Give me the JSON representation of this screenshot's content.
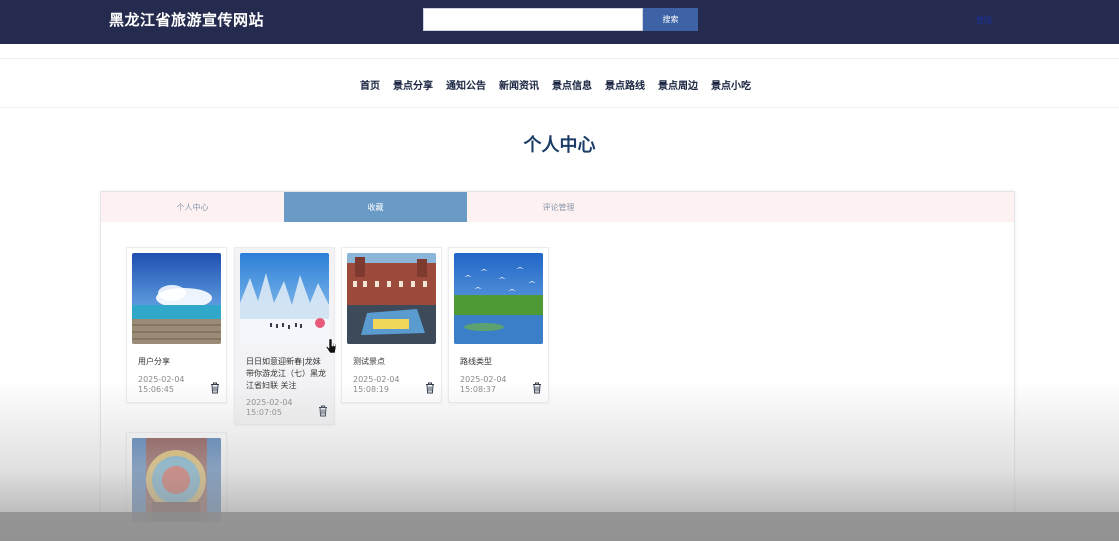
{
  "header": {
    "site_title": "黑龙江省旅游宣传网站",
    "search_placeholder": "",
    "search_button": "搜索",
    "login_link": "登陆"
  },
  "nav": {
    "items": [
      "首页",
      "景点分享",
      "通知公告",
      "新闻资讯",
      "景点信息",
      "景点路线",
      "景点周边",
      "景点小吃"
    ]
  },
  "page_title": "个人中心",
  "tabs": [
    {
      "label": "个人中心",
      "active": false
    },
    {
      "label": "收藏",
      "active": true
    },
    {
      "label": "评论管理",
      "active": false
    }
  ],
  "favorites": [
    {
      "title": "用户分享",
      "date": "2025-02-04",
      "time": "15:06:45",
      "image": "ocean-pier"
    },
    {
      "title": "日日如意迎新春|龙妹带你游龙江（七）黑龙江省妇联 关注",
      "date": "2025-02-04",
      "time": "15:07:05",
      "image": "snow-forest"
    },
    {
      "title": "测试景点",
      "date": "2025-02-04",
      "time": "15:08:19",
      "image": "castle-building"
    },
    {
      "title": "路线类型",
      "date": "2025-02-04",
      "time": "15:08:37",
      "image": "wetland-birds"
    },
    {
      "title": "",
      "date": "",
      "time": "",
      "image": "ornate-plate"
    }
  ],
  "colors": {
    "topbar": "#252b4f",
    "search_button": "#3d63a6",
    "tab_active": "#6a9bc6",
    "tab_bar": "#fdf2f1",
    "title": "#1b3d68"
  }
}
